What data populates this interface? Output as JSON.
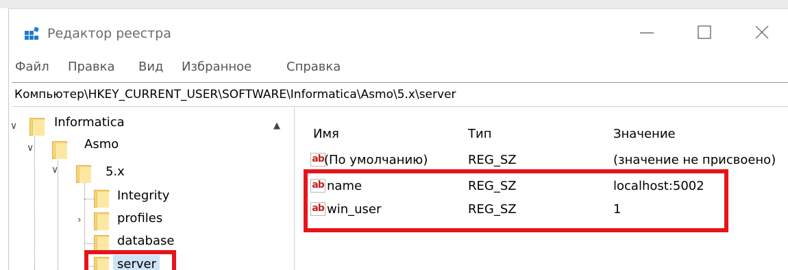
{
  "window": {
    "title": "Редактор реестра",
    "controls": {
      "minimize": "minimize-icon",
      "maximize": "maximize-icon",
      "close": "close-icon"
    }
  },
  "menu": [
    "Файл",
    "Правка",
    "Вид",
    "Избранное",
    "Справка"
  ],
  "address": "Компьютер\\HKEY_CURRENT_USER\\SOFTWARE\\Informatica\\Asmo\\5.x\\server",
  "tree": {
    "nodes": [
      {
        "label": "Informatica",
        "expanded": true
      },
      {
        "label": "Asmo",
        "expanded": true
      },
      {
        "label": "5.x",
        "expanded": true
      },
      {
        "label": "Integrity"
      },
      {
        "label": "profiles",
        "collapsed": true
      },
      {
        "label": "database"
      },
      {
        "label": "server",
        "selected": true
      }
    ]
  },
  "list": {
    "columns": [
      "Имя",
      "Тип",
      "Значение"
    ],
    "rows": [
      {
        "name": "(По умолчанию)",
        "type": "REG_SZ",
        "value": "(значение не присвоено)"
      },
      {
        "name": "name",
        "type": "REG_SZ",
        "value": "localhost:5002"
      },
      {
        "name": "win_user",
        "type": "REG_SZ",
        "value": "1"
      }
    ]
  },
  "icons": {
    "value": "ab",
    "folder": "folder-icon",
    "app": "registry-editor-icon"
  },
  "colors": {
    "highlight": "#e5141b",
    "folder": "#f6d577",
    "selection": "#cde3f6",
    "value_icon": "#c2231f"
  }
}
